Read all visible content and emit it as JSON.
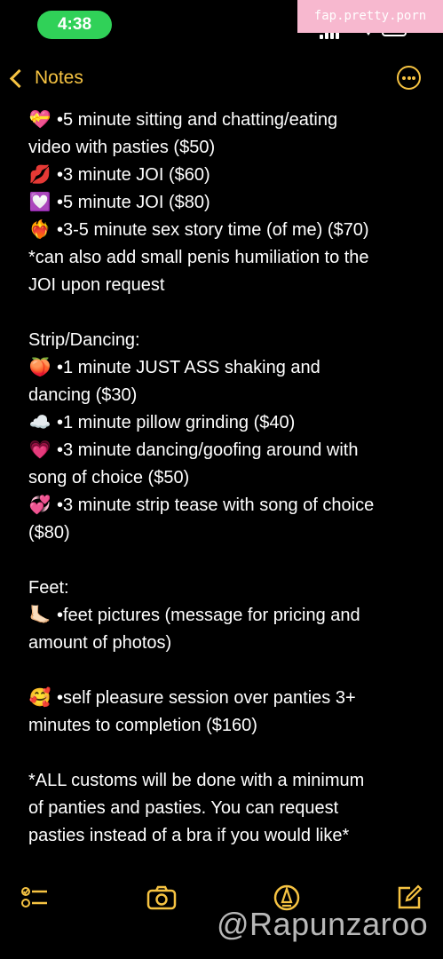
{
  "status_bar": {
    "time": "4:38"
  },
  "watermark": {
    "site": "fap.pretty.porn",
    "handle": "@Rapunzaroo"
  },
  "nav": {
    "back_label": "Notes"
  },
  "note": {
    "lines": [
      {
        "emoji": "💝",
        "text": "•5 minute sitting and chatting/eating"
      },
      {
        "emoji": "",
        "text": "video with pasties ($50)"
      },
      {
        "emoji": "💋",
        "text": "•3 minute JOI ($60)"
      },
      {
        "emoji": "💟",
        "text": "•5 minute JOI ($80)"
      },
      {
        "emoji": "❤️‍🔥",
        "text": "•3-5 minute sex story time (of me) ($70)"
      },
      {
        "emoji": "",
        "text": "*can also add small penis humiliation to the"
      },
      {
        "emoji": "",
        "text": "JOI upon request"
      },
      {
        "emoji": "",
        "text": ""
      },
      {
        "emoji": "",
        "text": "Strip/Dancing:"
      },
      {
        "emoji": "🍑",
        "text": "•1 minute JUST ASS shaking and"
      },
      {
        "emoji": "",
        "text": "dancing ($30)"
      },
      {
        "emoji": "☁️",
        "text": "•1 minute pillow grinding ($40)"
      },
      {
        "emoji": "💗",
        "text": "•3 minute dancing/goofing around with"
      },
      {
        "emoji": "",
        "text": "song of choice ($50)"
      },
      {
        "emoji": "💞",
        "text": "•3 minute strip tease with song of choice"
      },
      {
        "emoji": "",
        "text": "($80)"
      },
      {
        "emoji": "",
        "text": ""
      },
      {
        "emoji": "",
        "text": "Feet:"
      },
      {
        "emoji": "🦶🏻",
        "text": "•feet pictures (message for pricing and"
      },
      {
        "emoji": "",
        "text": "amount of photos)"
      },
      {
        "emoji": "",
        "text": ""
      },
      {
        "emoji": "🥰",
        "text": "•self pleasure session over panties 3+"
      },
      {
        "emoji": "",
        "text": "minutes to completion ($160)"
      },
      {
        "emoji": "",
        "text": ""
      },
      {
        "emoji": "",
        "text": "*ALL customs will be done with a minimum"
      },
      {
        "emoji": "",
        "text": "of panties and pasties. You can request"
      },
      {
        "emoji": "",
        "text": "pasties instead of a bra if you would like*"
      }
    ]
  },
  "colors": {
    "accent": "#f6c342",
    "status_pill": "#30d158",
    "watermark_badge": "#f7b8cf",
    "background": "#000000"
  },
  "icons": [
    "checklist-icon",
    "camera-icon",
    "markup-pen-icon",
    "compose-icon",
    "more-icon",
    "chevron-left-icon"
  ]
}
